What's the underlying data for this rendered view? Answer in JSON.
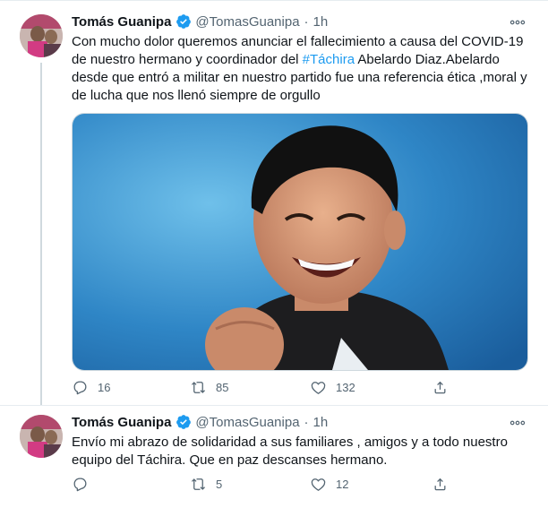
{
  "colors": {
    "accent": "#1d9bf0",
    "text": "#0f1419",
    "secondary": "#536471",
    "divider": "#e6ecf0"
  },
  "tweets": [
    {
      "author_name": "Tomás Guanipa",
      "handle": "@TomasGuanipa",
      "separator": "·",
      "time": "1h",
      "verified": true,
      "text_pre": "Con mucho dolor queremos anunciar el fallecimiento a causa del COVID-19 de nuestro hermano y coordinador del ",
      "hashtag": "#Táchira",
      "text_post": " Abelardo Diaz.Abelardo desde que entró a militar en nuestro partido fue una referencia ética ,moral y de lucha que nos llenó siempre de orgullo",
      "replies": "16",
      "retweets": "85",
      "likes": "132",
      "icons": [
        "more-icon",
        "reply-icon",
        "retweet-icon",
        "like-icon",
        "share-icon",
        "verified-badge-icon"
      ]
    },
    {
      "author_name": "Tomás Guanipa",
      "handle": "@TomasGuanipa",
      "separator": "·",
      "time": "1h",
      "verified": true,
      "text": "Envío mi abrazo de solidaridad a sus familiares , amigos y a todo nuestro equipo del Táchira. Que en paz descanses hermano.",
      "replies": "",
      "retweets": "5",
      "likes": "12"
    }
  ]
}
